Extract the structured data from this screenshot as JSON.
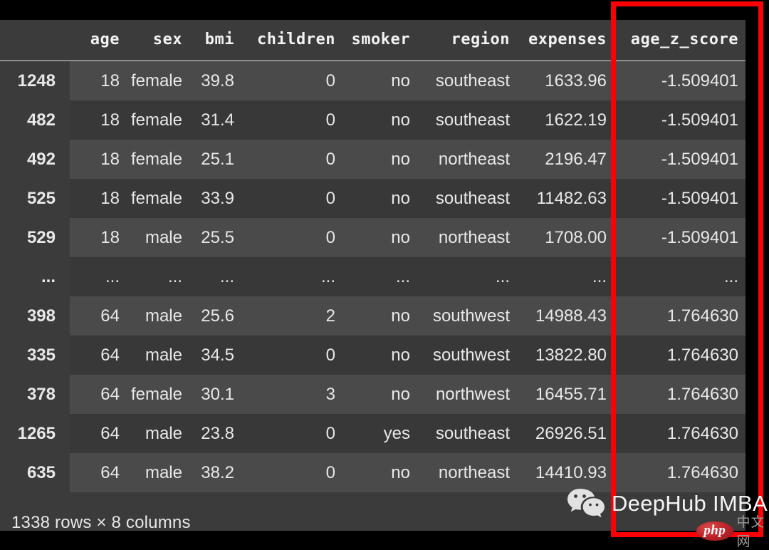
{
  "table": {
    "index_header": "",
    "columns": [
      "age",
      "sex",
      "bmi",
      "children",
      "smoker",
      "region",
      "expenses",
      "age_z_score"
    ],
    "highlighted_column": "age_z_score",
    "rows": [
      {
        "index": "1248",
        "age": "18",
        "sex": "female",
        "bmi": "39.8",
        "children": "0",
        "smoker": "no",
        "region": "southeast",
        "expenses": "1633.96",
        "age_z_score": "-1.509401"
      },
      {
        "index": "482",
        "age": "18",
        "sex": "female",
        "bmi": "31.4",
        "children": "0",
        "smoker": "no",
        "region": "southeast",
        "expenses": "1622.19",
        "age_z_score": "-1.509401"
      },
      {
        "index": "492",
        "age": "18",
        "sex": "female",
        "bmi": "25.1",
        "children": "0",
        "smoker": "no",
        "region": "northeast",
        "expenses": "2196.47",
        "age_z_score": "-1.509401"
      },
      {
        "index": "525",
        "age": "18",
        "sex": "female",
        "bmi": "33.9",
        "children": "0",
        "smoker": "no",
        "region": "southeast",
        "expenses": "11482.63",
        "age_z_score": "-1.509401"
      },
      {
        "index": "529",
        "age": "18",
        "sex": "male",
        "bmi": "25.5",
        "children": "0",
        "smoker": "no",
        "region": "northeast",
        "expenses": "1708.00",
        "age_z_score": "-1.509401"
      },
      {
        "index": "...",
        "age": "...",
        "sex": "...",
        "bmi": "...",
        "children": "...",
        "smoker": "...",
        "region": "...",
        "expenses": "...",
        "age_z_score": "..."
      },
      {
        "index": "398",
        "age": "64",
        "sex": "male",
        "bmi": "25.6",
        "children": "2",
        "smoker": "no",
        "region": "southwest",
        "expenses": "14988.43",
        "age_z_score": "1.764630"
      },
      {
        "index": "335",
        "age": "64",
        "sex": "male",
        "bmi": "34.5",
        "children": "0",
        "smoker": "no",
        "region": "southwest",
        "expenses": "13822.80",
        "age_z_score": "1.764630"
      },
      {
        "index": "378",
        "age": "64",
        "sex": "female",
        "bmi": "30.1",
        "children": "3",
        "smoker": "no",
        "region": "northwest",
        "expenses": "16455.71",
        "age_z_score": "1.764630"
      },
      {
        "index": "1265",
        "age": "64",
        "sex": "male",
        "bmi": "23.8",
        "children": "0",
        "smoker": "yes",
        "region": "southeast",
        "expenses": "26926.51",
        "age_z_score": "1.764630"
      },
      {
        "index": "635",
        "age": "64",
        "sex": "male",
        "bmi": "38.2",
        "children": "0",
        "smoker": "no",
        "region": "northeast",
        "expenses": "14410.93",
        "age_z_score": "1.764630"
      }
    ],
    "summary": "1338 rows × 8 columns"
  },
  "annotation": {
    "highlight_color": "#fd0005"
  },
  "watermark": {
    "brand": "DeepHub IMBA",
    "php_label": "php",
    "php_cn": "中文网"
  },
  "colors": {
    "background": "#000000",
    "panel": "#3b3b3b",
    "row_odd": "#4a4a4a",
    "row_even": "#383838",
    "text": "#e8e8e8",
    "rule": "#8e8e8e"
  }
}
